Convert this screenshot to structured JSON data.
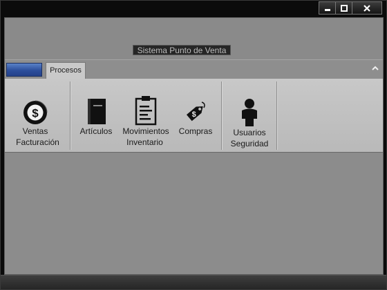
{
  "app": {
    "title": "Sistema Punto de Venta"
  },
  "ribbon": {
    "tabs": [
      {
        "label": "Procesos"
      }
    ],
    "groups": [
      {
        "buttons": [
          {
            "label": "Ventas",
            "icon": "dollar-icon"
          }
        ],
        "group_label": "Facturación"
      },
      {
        "buttons": [
          {
            "label": "Artículos",
            "icon": "book-icon"
          },
          {
            "label": "Movimientos",
            "icon": "clipboard-icon"
          },
          {
            "label": "Compras",
            "icon": "price-tag-icon"
          }
        ],
        "group_label": "Inventario"
      },
      {
        "buttons": [
          {
            "label": "Usuarios",
            "icon": "user-icon"
          }
        ],
        "group_label": "Seguridad"
      }
    ]
  },
  "window_controls": {
    "minimize_icon": "minimize-icon",
    "maximize_icon": "maximize-icon",
    "close_icon": "close-icon"
  },
  "colors": {
    "app_menu_blue": "#2d4f9c",
    "ribbon_panel": "#c8c8c8",
    "client_gray": "#8c8c8c"
  }
}
